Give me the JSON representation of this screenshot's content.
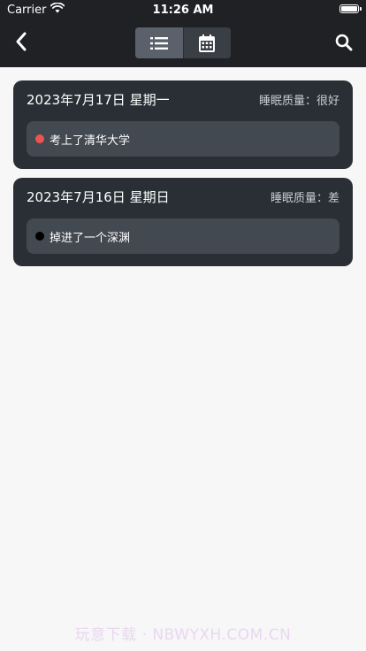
{
  "status_bar": {
    "carrier": "Carrier",
    "time": "11:26 AM"
  },
  "navbar": {
    "back_icon": "chevron-left-icon",
    "view_modes": [
      {
        "name": "list",
        "icon": "list-icon",
        "active": true
      },
      {
        "name": "calendar",
        "icon": "calendar-icon",
        "active": false
      }
    ],
    "search_icon": "search-icon"
  },
  "entries": [
    {
      "date": "2023年7月17日 星期一",
      "sleep_quality": "睡眠质量：很好",
      "dreams": [
        {
          "text": "考上了清华大学",
          "dot_color": "#ef5350"
        }
      ]
    },
    {
      "date": "2023年7月16日 星期日",
      "sleep_quality": "睡眠质量：差",
      "dreams": [
        {
          "text": "掉进了一个深渊",
          "dot_color": "#000000"
        }
      ]
    }
  ],
  "watermark": "玩意下载 · NBWYXH.COM.CN",
  "colors": {
    "header_bg": "#1f2124",
    "card_bg": "#2a2f35",
    "dream_item_bg": "#434951",
    "page_bg": "#f7f7f7"
  }
}
